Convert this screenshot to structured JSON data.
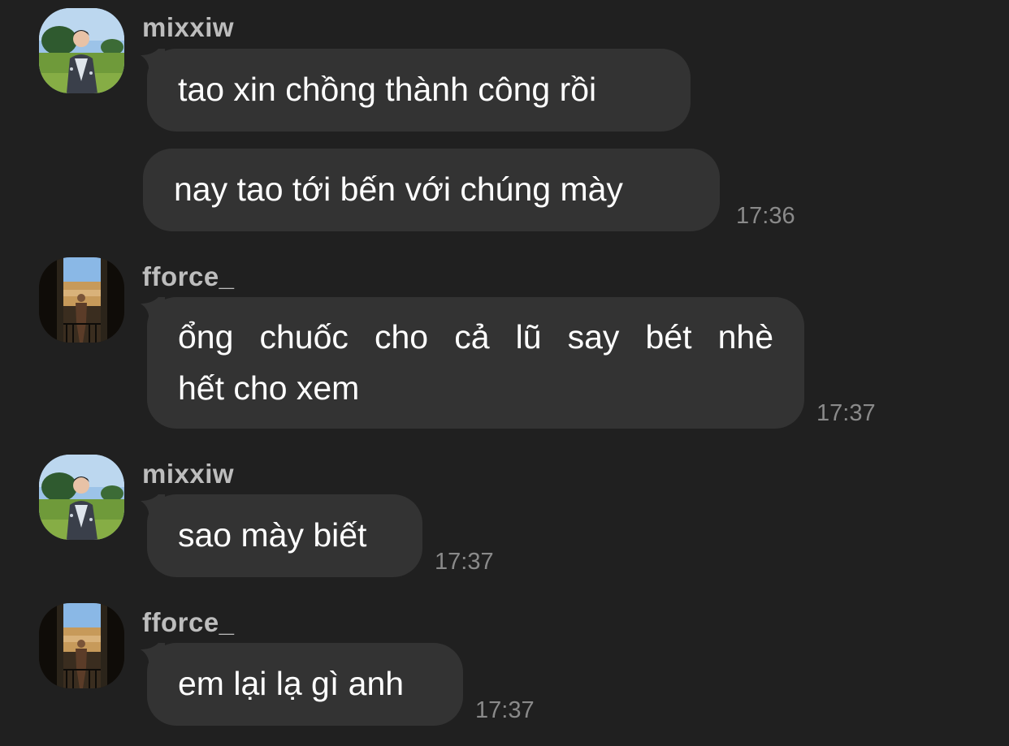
{
  "messages": [
    {
      "sender": "mixxiw",
      "texts": [
        "tao xin chồng thành công rồi",
        "nay tao tới bến với chúng mày"
      ],
      "time": "17:36"
    },
    {
      "sender": "fforce_",
      "lines": [
        "ổng chuốc cho cả lũ say bét nhè",
        "hết cho xem"
      ],
      "time": "17:37"
    },
    {
      "sender": "mixxiw",
      "texts": [
        "sao mày biết"
      ],
      "time": "17:37"
    },
    {
      "sender": "fforce_",
      "texts": [
        "em lại lạ gì anh"
      ],
      "time": "17:37"
    }
  ],
  "colors": {
    "background": "#202020",
    "bubble": "#333333",
    "sender": "#bdbdbd",
    "text": "#ffffff",
    "timestamp": "#8a8a8a"
  },
  "icons": {
    "avatar_mixxiw": "avatar-photo-park",
    "avatar_fforce": "avatar-photo-balcony"
  }
}
